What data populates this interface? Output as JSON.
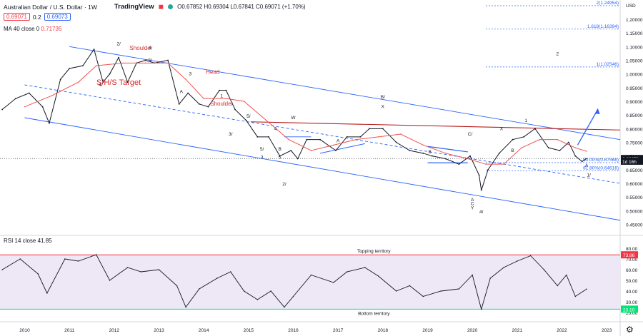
{
  "header": {
    "symbol": "Australian Dollar / U.S. Dollar · 1W",
    "brand": "TradingView",
    "bid": "0.69071",
    "spread": "0.2",
    "ask": "0.69073",
    "ohlc": "O0.67852 H0.69304 L0.67841 C0.69071 (+1.70%)",
    "currency": "USD"
  },
  "ma_label": {
    "name": "MA 40 close 0",
    "value": "0.71735"
  },
  "rsi_label": {
    "name": "RSI 14 close",
    "value": "41.85"
  },
  "colors": {
    "candles": "#131722",
    "ma": "#ef5350",
    "channel": "#2962ff",
    "resistance": "#b71c1c",
    "rsi_line": "#131722",
    "rsi_band": "#ede7f6",
    "up_bound": "#f23645",
    "low_bound": "#00e676"
  },
  "chart_data": [
    {
      "type": "line",
      "title": "Australian Dollar / U.S. Dollar · 1W",
      "x_tick_labels": [
        "2010",
        "2011",
        "2012",
        "2013",
        "2014",
        "2015",
        "2016",
        "2017",
        "2018",
        "2019",
        "2020",
        "2021",
        "2022",
        "2023"
      ],
      "y_tick_labels": [
        "0.45000",
        "0.50000",
        "0.55000",
        "0.60000",
        "0.65000",
        "0.70000",
        "0.75000",
        "0.80000",
        "0.85000",
        "0.90000",
        "0.95000",
        "1.00000",
        "1.05000",
        "1.10000",
        "1.15000",
        "1.20000"
      ],
      "ylim": [
        0.42,
        1.26
      ],
      "series": [
        {
          "name": "AUDUSD",
          "x": [
            "2009.5",
            "2009.8",
            "2010.1",
            "2010.4",
            "2010.55",
            "2010.8",
            "2011.0",
            "2011.3",
            "2011.55",
            "2011.75",
            "2011.9",
            "2012.1",
            "2012.3",
            "2012.5",
            "2012.7",
            "2012.9",
            "2013.2",
            "2013.45",
            "2013.65",
            "2013.9",
            "2014.1",
            "2014.35",
            "2014.5",
            "2014.7",
            "2014.95",
            "2015.2",
            "2015.45",
            "2015.7",
            "2015.95",
            "2016.1",
            "2016.3",
            "2016.6",
            "2016.95",
            "2017.2",
            "2017.5",
            "2017.7",
            "2018.0",
            "2018.3",
            "2018.6",
            "2018.9",
            "2019.1",
            "2019.4",
            "2019.7",
            "2019.95",
            "2020.15",
            "2020.2",
            "2020.35",
            "2020.6",
            "2020.9",
            "2021.15",
            "2021.4",
            "2021.7",
            "2021.95",
            "2022.15",
            "2022.3",
            "2022.45",
            "2022.55"
          ],
          "values": [
            0.87,
            0.91,
            0.93,
            0.88,
            0.82,
            0.98,
            1.02,
            1.03,
            1.09,
            0.97,
            1.0,
            1.06,
            0.97,
            1.04,
            1.05,
            1.04,
            1.05,
            0.89,
            0.93,
            0.89,
            0.88,
            0.94,
            0.94,
            0.87,
            0.83,
            0.77,
            0.77,
            0.7,
            0.72,
            0.69,
            0.76,
            0.76,
            0.72,
            0.77,
            0.77,
            0.8,
            0.8,
            0.75,
            0.72,
            0.71,
            0.7,
            0.69,
            0.67,
            0.7,
            0.63,
            0.575,
            0.65,
            0.71,
            0.76,
            0.77,
            0.8,
            0.73,
            0.72,
            0.75,
            0.7,
            0.68,
            0.69071
          ]
        },
        {
          "name": "MA 40 close 0",
          "x": [
            "2010.0",
            "2010.6",
            "2011.2",
            "2011.6",
            "2012.2",
            "2012.7",
            "2013.2",
            "2013.6",
            "2014.0",
            "2014.5",
            "2014.9",
            "2015.4",
            "2015.9",
            "2016.4",
            "2016.9",
            "2017.4",
            "2017.9",
            "2018.4",
            "2018.9",
            "2019.4",
            "2019.9",
            "2020.3",
            "2020.7",
            "2021.1",
            "2021.5",
            "2021.9",
            "2022.3",
            "2022.55"
          ],
          "values": [
            0.88,
            0.92,
            0.97,
            1.03,
            1.04,
            1.04,
            1.04,
            0.98,
            0.91,
            0.91,
            0.9,
            0.83,
            0.76,
            0.72,
            0.74,
            0.76,
            0.77,
            0.78,
            0.74,
            0.71,
            0.69,
            0.67,
            0.67,
            0.73,
            0.76,
            0.76,
            0.73,
            0.71735
          ]
        }
      ],
      "price_labels": [
        {
          "text": "0.69071",
          "value": 0.69071
        },
        {
          "text": "1d 16h",
          "value": 0.681
        }
      ],
      "fib_levels": [
        {
          "label": "2(1.24954)",
          "value": 1.24954
        },
        {
          "label": "1.618(1.16394)",
          "value": 1.16394
        },
        {
          "label": "1(1.02546)",
          "value": 1.02546
        },
        {
          "label": "50.00%(0.67568)",
          "value": 0.67568
        },
        {
          "label": "61.80%(0.64616)",
          "value": 0.64616
        }
      ],
      "annotations": [
        "S/H/S Target",
        "Shoulder",
        "Shoulder",
        "Head",
        "B",
        "2",
        "2/",
        "1/",
        "4/",
        "2/",
        "4",
        "3/",
        "5/",
        "3",
        "A",
        "1",
        "4/",
        "3/",
        "4",
        "5/",
        "3",
        "5",
        "W",
        "A",
        "B/",
        "X",
        "C/",
        "B",
        "A",
        "C",
        "Y",
        "X",
        "1",
        "B",
        "A",
        "2"
      ]
    },
    {
      "type": "line",
      "title": "RSI 14 close",
      "y_tick_labels": [
        "20.00",
        "30.00",
        "40.00",
        "50.00",
        "60.00",
        "70.00",
        "80.00"
      ],
      "ylim": [
        14,
        84
      ],
      "bounds": [
        {
          "value": 73.86,
          "text": "73.86"
        },
        {
          "value": 23.1,
          "text": "23.10"
        }
      ],
      "band_labels": [
        "Topping territory",
        "Bottom territory"
      ],
      "series": [
        {
          "name": "RSI 14 close",
          "x": [
            "2009.5",
            "2009.9",
            "2010.3",
            "2010.5",
            "2010.9",
            "2011.2",
            "2011.6",
            "2011.9",
            "2012.3",
            "2012.6",
            "2013.0",
            "2013.4",
            "2013.6",
            "2013.9",
            "2014.3",
            "2014.6",
            "2014.9",
            "2015.2",
            "2015.5",
            "2015.8",
            "2016.0",
            "2016.4",
            "2016.9",
            "2017.2",
            "2017.6",
            "2017.9",
            "2018.3",
            "2018.6",
            "2018.9",
            "2019.3",
            "2019.7",
            "2020.0",
            "2020.2",
            "2020.4",
            "2020.7",
            "2021.0",
            "2021.3",
            "2021.6",
            "2021.9",
            "2022.1",
            "2022.3",
            "2022.55"
          ],
          "values": [
            60,
            70,
            56,
            38,
            70,
            68,
            74,
            50,
            62,
            58,
            60,
            45,
            25,
            42,
            52,
            58,
            40,
            32,
            40,
            25,
            35,
            55,
            48,
            58,
            62,
            54,
            40,
            45,
            35,
            40,
            42,
            55,
            23,
            52,
            62,
            68,
            73,
            60,
            45,
            55,
            35,
            41.85
          ]
        }
      ]
    }
  ]
}
